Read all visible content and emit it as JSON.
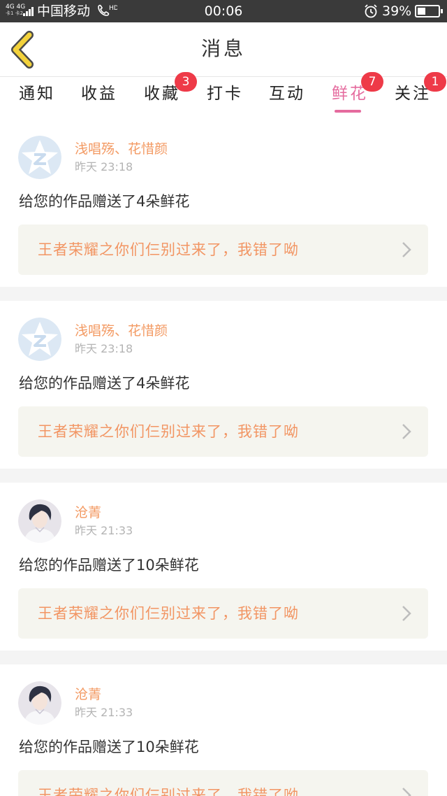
{
  "status_bar": {
    "network": "4G 4G",
    "sim": "卡1 卡2",
    "carrier": "中国移动",
    "hd": "HD",
    "time": "00:06",
    "battery_percent": "39%",
    "battery_level": 0.39
  },
  "header": {
    "back_icon": "chevron-left-icon",
    "title": "消息"
  },
  "tabs": [
    {
      "label": "通知",
      "badge": ""
    },
    {
      "label": "收益",
      "badge": ""
    },
    {
      "label": "收藏",
      "badge": "3"
    },
    {
      "label": "打卡",
      "badge": ""
    },
    {
      "label": "互动",
      "badge": ""
    },
    {
      "label": "鲜花",
      "badge": "7",
      "active": true
    },
    {
      "label": "关注",
      "badge": "1"
    }
  ],
  "messages": [
    {
      "user": "浅唱殇、花惜颜",
      "time": "昨天 23:18",
      "text": "给您的作品赠送了4朵鲜花",
      "work": "王者荣耀之你们仨别过来了，我错了呦",
      "avatar": "default-z-avatar"
    },
    {
      "user": "浅唱殇、花惜颜",
      "time": "昨天 23:18",
      "text": "给您的作品赠送了4朵鲜花",
      "work": "王者荣耀之你们仨别过来了，我错了呦",
      "avatar": "default-z-avatar"
    },
    {
      "user": "沧菁",
      "time": "昨天 21:33",
      "text": "给您的作品赠送了10朵鲜花",
      "work": "王者荣耀之你们仨别过来了，我错了呦",
      "avatar": "anime-portrait-avatar"
    },
    {
      "user": "沧菁",
      "time": "昨天 21:33",
      "text": "给您的作品赠送了10朵鲜花",
      "work": "王者荣耀之你们仨别过来了，我错了呦",
      "avatar": "anime-portrait-avatar"
    }
  ],
  "colors": {
    "accent_pink": "#e56b9e",
    "username_orange": "#f39a63",
    "badge_red": "#ee3a48",
    "status_bar_bg": "#3a3a3a"
  }
}
